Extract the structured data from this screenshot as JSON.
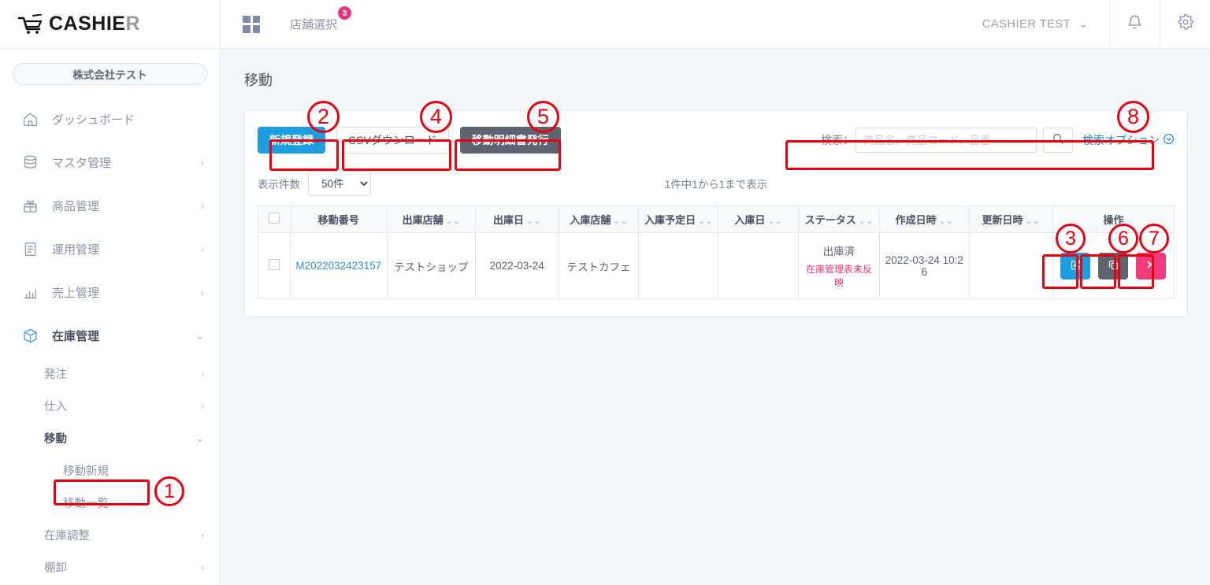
{
  "brand": {
    "name_main": "CASHIE",
    "name_tail": "R",
    "cart_icon": "shopping-cart-icon"
  },
  "sidebar": {
    "company_label": "株式会社テスト",
    "items": [
      {
        "label": "ダッシュボード",
        "icon": "home-icon",
        "chevron": ""
      },
      {
        "label": "マスタ管理",
        "icon": "database-icon",
        "chevron": "›"
      },
      {
        "label": "商品管理",
        "icon": "gift-icon",
        "chevron": "›"
      },
      {
        "label": "運用管理",
        "icon": "clipboard-icon",
        "chevron": "›"
      },
      {
        "label": "売上管理",
        "icon": "bar-chart-icon",
        "chevron": "›"
      },
      {
        "label": "在庫管理",
        "icon": "box-icon",
        "chevron": "⌄"
      }
    ],
    "sub_items": [
      {
        "label": "発注",
        "chevron": "›"
      },
      {
        "label": "仕入",
        "chevron": "›"
      },
      {
        "label": "移動",
        "chevron": "⌄"
      }
    ],
    "move_children": [
      {
        "label": "移動新規"
      },
      {
        "label": "移動一覧"
      }
    ],
    "sub_items_tail": [
      {
        "label": "在庫調整",
        "chevron": "›"
      },
      {
        "label": "棚卸",
        "chevron": "›"
      }
    ]
  },
  "header": {
    "grid_icon": "grid-icon",
    "store_select_label": "店舗選択",
    "store_badge_count": "3",
    "user_name": "CASHIER  TEST",
    "user_chevron": "⌄",
    "bell_icon": "bell-icon",
    "gear_icon": "gear-icon"
  },
  "main": {
    "page_title": "移動",
    "toolbar": {
      "new_label": "新規登録",
      "csv_label": "CSVダウンロード",
      "slip_label": "移動明細書発行"
    },
    "search": {
      "label": "検索：",
      "placeholder": "商品名、商品コード、品番",
      "value": "",
      "search_icon": "search-icon",
      "options_label": "検索オプション",
      "options_chevron": "⌄"
    },
    "listbar": {
      "per_page_label": "表示件数",
      "per_page_value": "50件",
      "per_page_options": [
        "50件"
      ],
      "count_info": "1件中1から1まで表示"
    },
    "table": {
      "columns": [
        {
          "label": "",
          "sortable": false,
          "key": "checkbox"
        },
        {
          "label": "移動番号",
          "sortable": false
        },
        {
          "label": "出庫店舗",
          "sortable": true
        },
        {
          "label": "出庫日",
          "sortable": true
        },
        {
          "label": "入庫店舗",
          "sortable": true
        },
        {
          "label": "入庫予定日",
          "sortable": true
        },
        {
          "label": "入庫日",
          "sortable": true
        },
        {
          "label": "ステータス",
          "sortable": true
        },
        {
          "label": "作成日時",
          "sortable": true
        },
        {
          "label": "更新日時",
          "sortable": true
        },
        {
          "label": "操作",
          "sortable": false
        }
      ],
      "sort_glyph": "⌄⌄",
      "rows": [
        {
          "move_no": "M2022032423157",
          "out_store": "テストショップ",
          "out_date": "2022-03-24",
          "in_store": "テストカフェ",
          "in_plan_date": "",
          "in_date": "",
          "status_main": "出庫済",
          "status_sub": "在庫管理表未反映",
          "created_at": "2022-03-24 10:26",
          "updated_at": "",
          "actions": [
            {
              "name": "edit-row-button",
              "icon": "pencil-square-icon",
              "color": "#1c9ee0"
            },
            {
              "name": "copy-row-button",
              "icon": "copy-icon",
              "color": "#5d6470"
            },
            {
              "name": "delete-row-button",
              "icon": "close-x-icon",
              "color": "#ed3b7e"
            }
          ]
        }
      ]
    }
  },
  "annotations": [
    {
      "num": "1",
      "target": "sidebar-item-move-list"
    },
    {
      "num": "2",
      "target": "new-register-button"
    },
    {
      "num": "3",
      "target": "edit-row-button"
    },
    {
      "num": "4",
      "target": "csv-download-button"
    },
    {
      "num": "5",
      "target": "issue-slip-button"
    },
    {
      "num": "6",
      "target": "copy-row-button"
    },
    {
      "num": "7",
      "target": "delete-row-button"
    },
    {
      "num": "8",
      "target": "search-area"
    }
  ],
  "colors": {
    "primary": "#1c9ee0",
    "dark": "#5d6470",
    "danger": "#ed3b7e",
    "accent_pink": "#e8367f",
    "link": "#3a8fd4",
    "annotation": "#e60012",
    "page_bg": "#f4f7fa"
  }
}
